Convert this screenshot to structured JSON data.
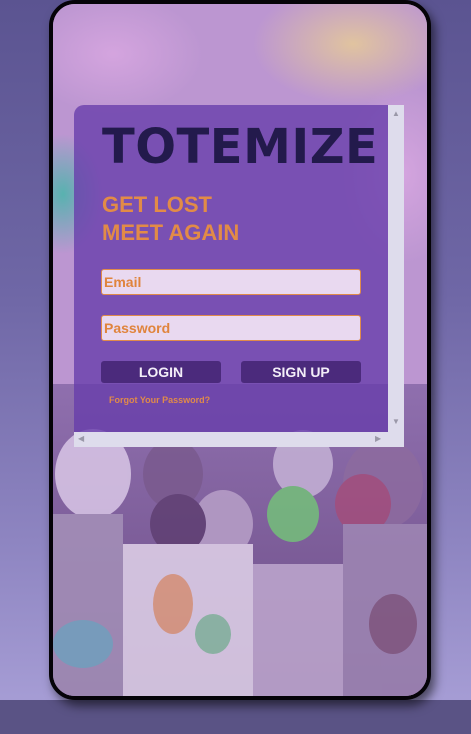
{
  "app": {
    "title": "TOTEMIZE",
    "tagline": [
      "GET LOST",
      "MEET AGAIN"
    ]
  },
  "form": {
    "email_placeholder": "Email",
    "password_placeholder": "Password",
    "login_label": "LOGIN",
    "signup_label": "SIGN UP",
    "forgot_label": "Forgot Your Password?"
  },
  "scrollbar": {
    "up": "▲",
    "down": "▼",
    "left": "◀",
    "right": "▶"
  },
  "colors": {
    "title": "#231a4c",
    "accent": "#e28b47",
    "panel": "#663caa",
    "button": "#4b2a7c",
    "page_background": "#5b5491"
  },
  "icons": [
    "background-photo"
  ]
}
